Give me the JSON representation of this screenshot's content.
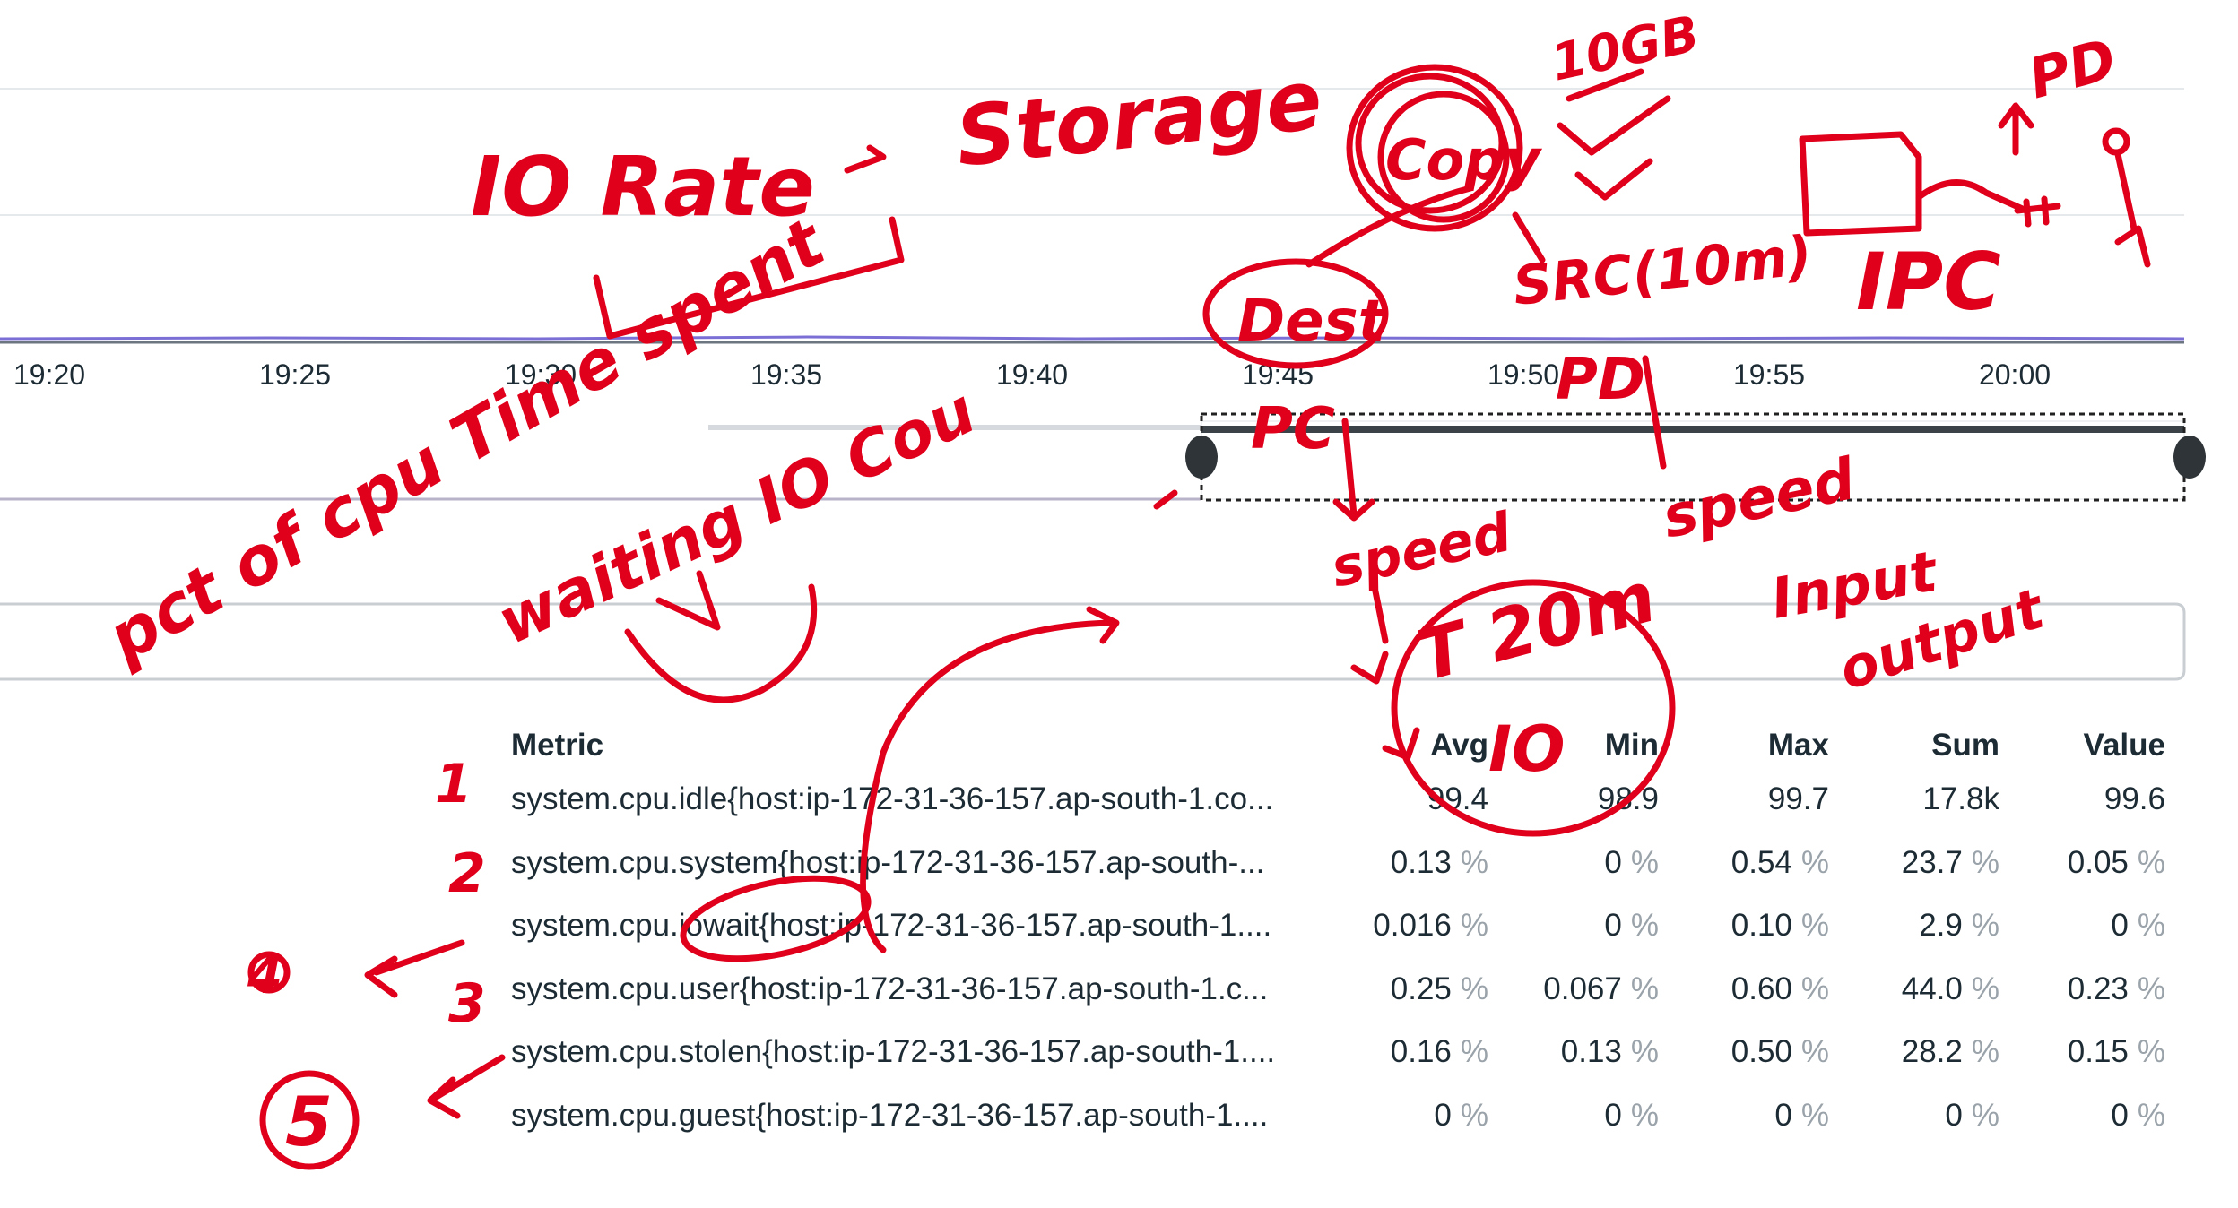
{
  "timeseries": {
    "x_ticks": [
      "19:20",
      "19:25",
      "19:30",
      "19:35",
      "19:40",
      "19:45",
      "19:50",
      "19:55",
      "20:00"
    ]
  },
  "table": {
    "headers": {
      "metric": "Metric",
      "avg": "Avg",
      "min": "Min",
      "max": "Max",
      "sum": "Sum",
      "value": "Value"
    },
    "rows": [
      {
        "metric": "system.cpu.idle{host:ip-172-31-36-157.ap-south-1.co...",
        "avg": "99.4",
        "avg_u": "",
        "min": "98.9",
        "min_u": "",
        "max": "99.7",
        "max_u": "",
        "sum": "17.8k",
        "sum_u": "",
        "value": "99.6",
        "value_u": ""
      },
      {
        "metric": "system.cpu.system{host:ip-172-31-36-157.ap-south-...",
        "avg": "0.13",
        "avg_u": "%",
        "min": "0",
        "min_u": "%",
        "max": "0.54",
        "max_u": "%",
        "sum": "23.7",
        "sum_u": "%",
        "value": "0.05",
        "value_u": "%"
      },
      {
        "metric": "system.cpu.iowait{host:ip-172-31-36-157.ap-south-1....",
        "avg": "0.016",
        "avg_u": "%",
        "min": "0",
        "min_u": "%",
        "max": "0.10",
        "max_u": "%",
        "sum": "2.9",
        "sum_u": "%",
        "value": "0",
        "value_u": "%"
      },
      {
        "metric": "system.cpu.user{host:ip-172-31-36-157.ap-south-1.c...",
        "avg": "0.25",
        "avg_u": "%",
        "min": "0.067",
        "min_u": "%",
        "max": "0.60",
        "max_u": "%",
        "sum": "44.0",
        "sum_u": "%",
        "value": "0.23",
        "value_u": "%"
      },
      {
        "metric": "system.cpu.stolen{host:ip-172-31-36-157.ap-south-1....",
        "avg": "0.16",
        "avg_u": "%",
        "min": "0.13",
        "min_u": "%",
        "max": "0.50",
        "max_u": "%",
        "sum": "28.2",
        "sum_u": "%",
        "value": "0.15",
        "value_u": "%"
      },
      {
        "metric": "system.cpu.guest{host:ip-172-31-36-157.ap-south-1....",
        "avg": "0",
        "avg_u": "%",
        "min": "0",
        "min_u": "%",
        "max": "0",
        "max_u": "%",
        "sum": "0",
        "sum_u": "%",
        "value": "0",
        "value_u": "%"
      }
    ]
  },
  "annotations": {
    "io_rate": "IO Rate",
    "storage": "Storage",
    "copy": "Copy",
    "size": "10GB",
    "dest": "Dest",
    "src": "SRC(10m)",
    "ipc": "IPC",
    "pd_top": "PD",
    "pd_mid": "PD",
    "pc": "PC",
    "speed1": "speed",
    "speed2": "speed",
    "t20m": "T 20m",
    "io": "IO",
    "pct": "pct of cpu Time spent",
    "waiting": "waiting IO Cou",
    "input": "Input",
    "output": "output",
    "n1": "1",
    "n2": "2",
    "n3": "3",
    "n4": "4",
    "n5": "5"
  },
  "colors": {
    "ink": "#e0001b",
    "text": "#1c2b34",
    "muted": "#9aa3aa",
    "line": "#6b7680",
    "series": "#7b6fd6"
  }
}
